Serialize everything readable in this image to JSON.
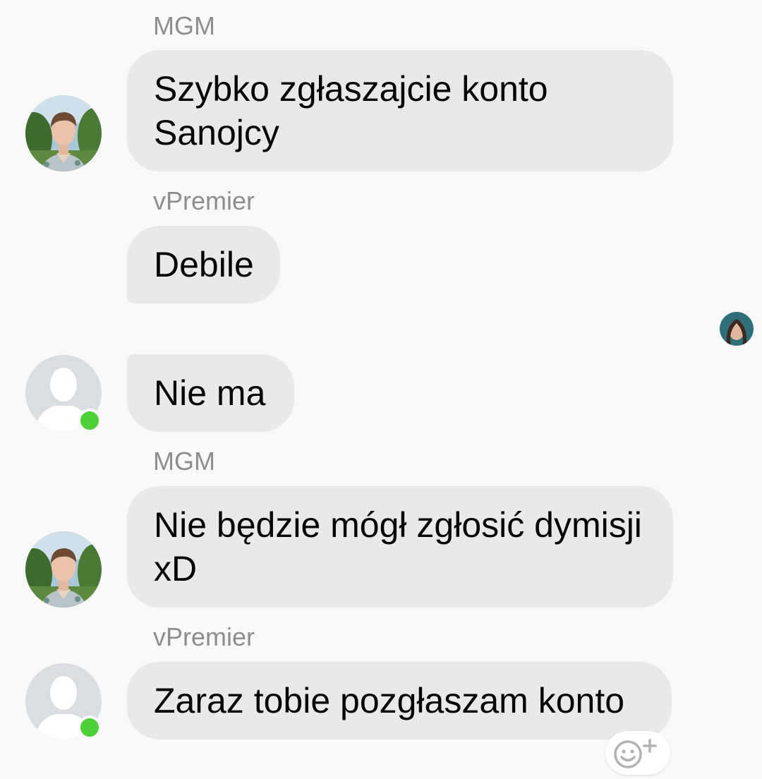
{
  "messages": [
    {
      "sender": "MGM",
      "text": "Szybko zgłaszajcie konto Sanojcy"
    },
    {
      "sender": "vPremier",
      "text": "Debile"
    },
    {
      "sender": "",
      "text": "Nie ma"
    },
    {
      "sender": "MGM",
      "text": "Nie będzie mógł zgłosić dymisji xD"
    },
    {
      "sender": "vPremier",
      "text": "Zaraz tobie pozgłaszam konto"
    }
  ],
  "icons": {
    "photo_avatar": "user-photo-avatar-icon",
    "default_avatar": "default-user-avatar-icon",
    "read_receipt": "read-receipt-avatar-icon",
    "reaction": "add-reaction-icon"
  },
  "colors": {
    "background": "#f9f9f9",
    "bubble": "#e9e9e9",
    "sender_name": "#8e8e8e",
    "online": "#4cd137"
  }
}
